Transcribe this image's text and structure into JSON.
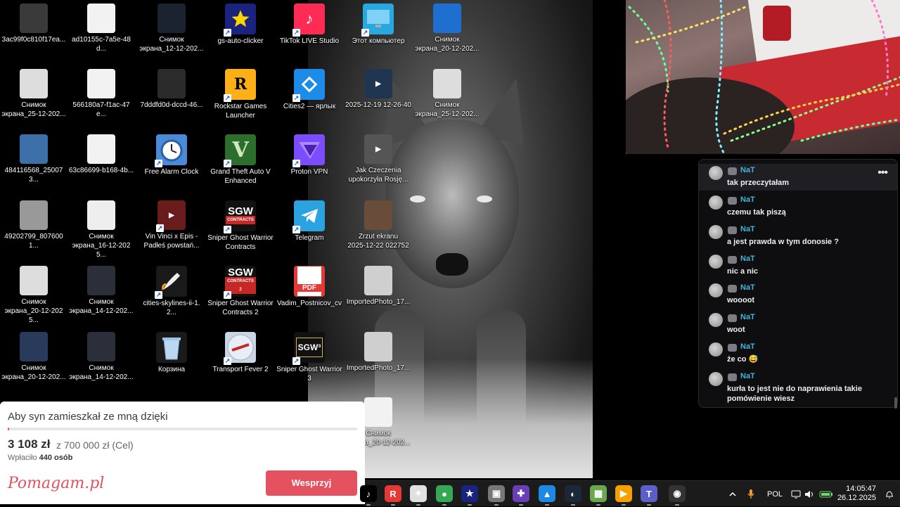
{
  "desktop": {
    "icons": [
      {
        "label": "3ac99f0c810f17ea...",
        "icon": "image-thumbnail-icon",
        "color": "#3a3a3a"
      },
      {
        "label": "ad10155c-7a5e-48d...",
        "icon": "document-thumbnail-icon",
        "color": "#f2f2f2"
      },
      {
        "label": "Снимок\nэкрана_12-12-202...",
        "icon": "screenshot-thumbnail-icon",
        "color": "#1c2330"
      },
      {
        "label": "gs-auto-clicker",
        "icon": "star-icon",
        "color": "#1a237e"
      },
      {
        "label": "TikTok LIVE Studio",
        "icon": "tiktok-icon",
        "color": "#fe2c55"
      },
      {
        "label": "Этот компьютер",
        "icon": "monitor-icon",
        "color": "#29a8e0"
      },
      {
        "label": "Снимок\nэкрана_20-12-202...",
        "icon": "screenshot-thumbnail-icon",
        "color": "#1e6fcf"
      },
      {
        "label": "Снимок\nэкрана_25-12-202...",
        "icon": "screenshot-thumbnail-icon",
        "color": "#ddd"
      },
      {
        "label": "566180a7-f1ac-47e...",
        "icon": "document-thumbnail-icon",
        "color": "#f2f2f2"
      },
      {
        "label": "7dddfd0d-dccd-46...",
        "icon": "image-thumbnail-icon",
        "color": "#2b2b2b"
      },
      {
        "label": "Rockstar Games\nLauncher",
        "icon": "rockstar-icon",
        "color": "#fcaf17"
      },
      {
        "label": "Cities2 — ярлык",
        "icon": "cities-skylines-icon",
        "color": "#1d8be8"
      },
      {
        "label": "2025-12-19 12-26-40",
        "icon": "video-thumbnail-icon",
        "color": "#1f3550"
      },
      {
        "label": "Снимок\nэкрана_25-12-202...",
        "icon": "screenshot-thumbnail-icon",
        "color": "#ddd"
      },
      {
        "label": "484116568_250073...",
        "icon": "image-thumbnail-icon",
        "color": "#3d6fa8"
      },
      {
        "label": "63c86699-b168-4b...",
        "icon": "document-thumbnail-icon",
        "color": "#f2f2f2"
      },
      {
        "label": "Free Alarm Clock",
        "icon": "alarm-clock-icon",
        "color": "#4b8ad6"
      },
      {
        "label": "Grand Theft Auto V\nEnhanced",
        "icon": "gta-v-icon",
        "color": "#2c6e2c"
      },
      {
        "label": "Proton VPN",
        "icon": "proton-vpn-icon",
        "color": "#7c4dff"
      },
      {
        "label": "Jak Czeczenia\nupokorzyła Rosję...",
        "icon": "video-thumbnail-icon",
        "color": "#555"
      },
      {
        "label": "49202799_8076001...",
        "icon": "image-thumbnail-icon",
        "color": "#999"
      },
      {
        "label": "Снимок\nэкрана_16-12-2025...",
        "icon": "screenshot-thumbnail-icon",
        "color": "#eee"
      },
      {
        "label": "Vin Vinci x Epis -\nPadłeś powstań...",
        "icon": "video-thumbnail-icon",
        "color": "#6a1b1b"
      },
      {
        "label": "Sniper Ghost Warrior\nContracts",
        "icon": "sgw-contracts-icon",
        "color": "#111"
      },
      {
        "label": "Telegram",
        "icon": "telegram-icon",
        "color": "#2aa3e0"
      },
      {
        "label": "Zrzut ekranu\n2025-12-22 022752",
        "icon": "screenshot-thumbnail-icon",
        "color": "#6a4c3a"
      },
      {
        "label": "Снимок\nэкрана_20-12-2025...",
        "icon": "screenshot-thumbnail-icon",
        "color": "#ddd"
      },
      {
        "label": "Снимок\nэкрана_14-12-202...",
        "icon": "screenshot-thumbnail-icon",
        "color": "#2a2f3a"
      },
      {
        "label": "cities-skylines-ii-1.2...",
        "icon": "rocket-icon",
        "color": "#1a1a1a"
      },
      {
        "label": "Sniper Ghost Warrior\nContracts 2",
        "icon": "sgw-contracts-2-icon",
        "color": "#111"
      },
      {
        "label": "Vadim_Postnicov_cv",
        "icon": "pdf-icon",
        "color": "#e53935"
      },
      {
        "label": "ImportedPhoto_17...",
        "icon": "photo-thumbnail-icon",
        "color": "#cfcfcf"
      },
      {
        "label": "Снимок\nэкрана_20-12-202...",
        "icon": "screenshot-thumbnail-icon",
        "color": "#2a3a5a"
      },
      {
        "label": "Снимок\nэкрана_14-12-202...",
        "icon": "screenshot-thumbnail-icon",
        "color": "#2a2f3a"
      },
      {
        "label": "Корзина",
        "icon": "recycle-bin-icon",
        "color": "#1a1a1a"
      },
      {
        "label": "Transport Fever 2",
        "icon": "transport-fever-icon",
        "color": "#c9d6e6"
      },
      {
        "label": "Sniper Ghost Warrior\n3",
        "icon": "sgw3-icon",
        "color": "#111"
      },
      {
        "label": "ImportedPhoto_17...",
        "icon": "photo-thumbnail-icon",
        "color": "#cfcfcf"
      },
      {
        "label": "Снимок\nэкрана_20-12-202...",
        "icon": "document-thumbnail-icon",
        "color": "#f2f2f2"
      }
    ],
    "sgw_text": "SGW",
    "sgw_sub": "CONTRACTS",
    "sgw2_sub": "CONTRACTS 2",
    "pdf_text": "PDF",
    "sgw3_text": "SGW³"
  },
  "chat": {
    "messages": [
      {
        "user": "NaT",
        "text": "tak przeczytałam"
      },
      {
        "user": "NaT",
        "text": "czemu tak piszą"
      },
      {
        "user": "NaT",
        "text": "a jest prawda w tym donosie ?"
      },
      {
        "user": "NaT",
        "text": "nic a nic"
      },
      {
        "user": "NaT",
        "text": "woooot"
      },
      {
        "user": "NaT",
        "text": "woot"
      },
      {
        "user": "NaT",
        "text": "że co 😅"
      },
      {
        "user": "NaT",
        "text": "kurła to jest nie do naprawienia takie pomówienie wiesz"
      }
    ],
    "more": "•••"
  },
  "donation": {
    "title": "Aby syn zamieszkał ze mną dzięki",
    "amount": "3 108 zł",
    "goal": "z 700 000 zł (Cel)",
    "donors_label": "Wpłaciło",
    "donors_count": "440 osób",
    "progress_fraction": 0.0044,
    "logo": "Pomagam.pl",
    "button": "Wesprzyj",
    "accent": "#e5525f"
  },
  "taskbar": {
    "apps": [
      {
        "icon": "tiktok-icon",
        "glyph": "♪",
        "color": "#000"
      },
      {
        "icon": "rockstar-icon",
        "glyph": "R",
        "color": "#e53935"
      },
      {
        "icon": "chrome-canary-icon",
        "glyph": "✦",
        "color": "#e0e0e0"
      },
      {
        "icon": "chrome-icon",
        "glyph": "●",
        "color": "#34a853"
      },
      {
        "icon": "star-icon",
        "glyph": "★",
        "color": "#1a237e"
      },
      {
        "icon": "package-icon",
        "glyph": "▣",
        "color": "#777"
      },
      {
        "icon": "app-grid-icon",
        "glyph": "✚",
        "color": "#6a3fb5"
      },
      {
        "icon": "photos-icon",
        "glyph": "▲",
        "color": "#1e88e5"
      },
      {
        "icon": "steam-icon",
        "glyph": "◐",
        "color": "#1b2838"
      },
      {
        "icon": "game-icon",
        "glyph": "▦",
        "color": "#6aa84f"
      },
      {
        "icon": "media-player-icon",
        "glyph": "▶",
        "color": "#f6a000"
      },
      {
        "icon": "teams-icon",
        "glyph": "T",
        "color": "#5b5fc7"
      },
      {
        "icon": "obs-icon",
        "glyph": "◉",
        "color": "#333"
      }
    ],
    "language": "POL",
    "time": "14:05:47",
    "date": "26.12.2025"
  }
}
